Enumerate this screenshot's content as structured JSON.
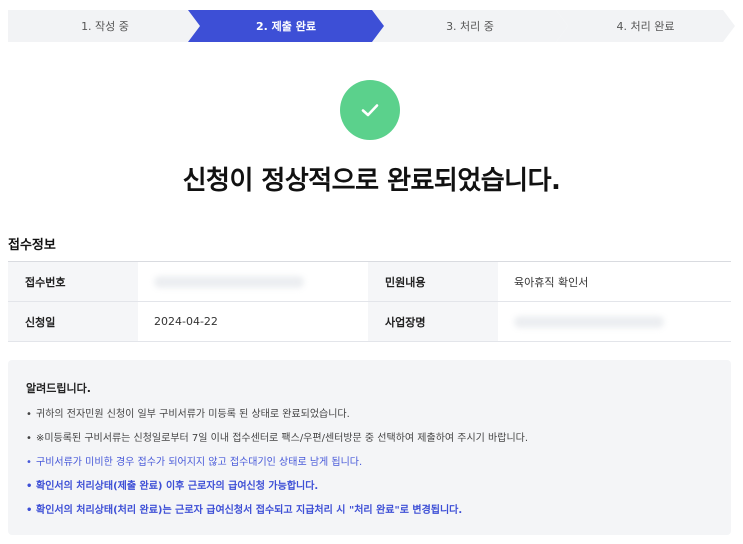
{
  "stepper": {
    "steps": [
      {
        "label": "1. 작성 중"
      },
      {
        "label": "2. 제출 완료"
      },
      {
        "label": "3. 처리 중"
      },
      {
        "label": "4. 처리 완료"
      }
    ],
    "active_index": 1,
    "active_color": "#3d4fd6"
  },
  "success": {
    "icon": "check-icon",
    "icon_color": "#5bd18c",
    "title": "신청이 정상적으로 완료되었습니다."
  },
  "receipt": {
    "section_title": "접수정보",
    "rows": [
      {
        "label1": "접수번호",
        "value1": "",
        "label2": "민원내용",
        "value2": "육아휴직 확인서"
      },
      {
        "label1": "신청일",
        "value1": "2024-04-22",
        "label2": "사업장명",
        "value2": ""
      }
    ]
  },
  "notice": {
    "title": "알려드립니다.",
    "items": [
      "귀하의 전자민원 신청이 일부 구비서류가 미등록 된 상태로 완료되었습니다.",
      "※미등록된 구비서류는 신청일로부터 7일 이내 접수센터로 팩스/우편/센터방문 중 선택하여 제출하여 주시기 바랍니다.",
      "구비서류가 미비한 경우 접수가 되어지지 않고 접수대기인 상태로 남게 됩니다.",
      "확인서의 처리상태(제출 완료) 이후 근로자의 급여신청 가능합니다.",
      "확인서의 처리상태(처리 완료)는 근로자 급여신청서 접수되고 지급처리 시 \"처리 완료\"로 변경됩니다."
    ]
  }
}
